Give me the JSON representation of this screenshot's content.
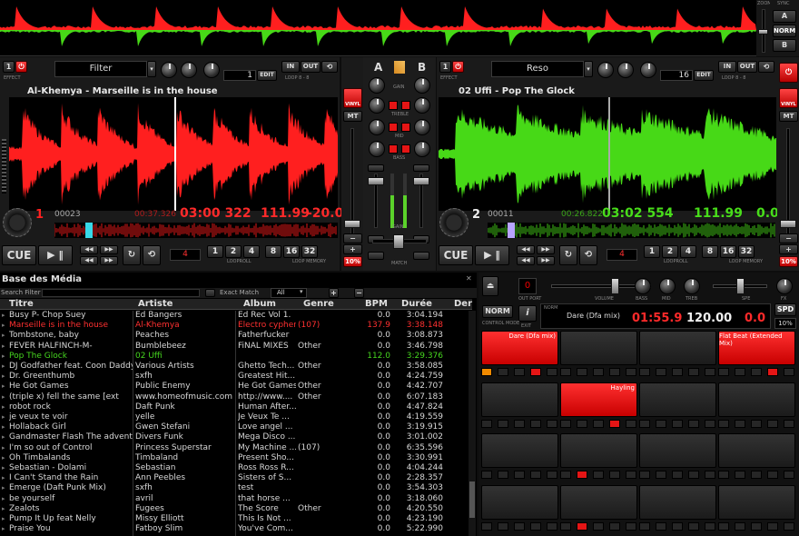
{
  "colors": {
    "deck_a_wave": "#ff1f1f",
    "deck_b_wave": "#47d917",
    "accent_red": "#e51515",
    "lib_red": "#ff3030",
    "lib_green": "#46d61f"
  },
  "top": {
    "zoom_label": "ZOOM",
    "sync_label": "SYNC",
    "btn_a": "A",
    "btn_norm": "NORM",
    "btn_b": "B"
  },
  "deckA": {
    "effect_name": "Filter",
    "effect_label": "EFFECT",
    "loop_value": "1",
    "edit": "EDIT",
    "loop_label": "LOOP 8 - 8",
    "in": "IN",
    "out": "OUT",
    "track": "Al-Khemya - Marseille is in the house",
    "deck_num": "1",
    "beat_count": "00023",
    "elapsed": "00:37.326",
    "remain": "03:00 322",
    "bpm": "111.99",
    "pitch": "-20.0",
    "cue": "CUE",
    "loop_display": "4",
    "loop_roll_label": "LOOPROLL",
    "loop_memory_label": "LOOP MEMORY",
    "loop_nums": [
      "1",
      "2",
      "4",
      "8",
      "16",
      "32"
    ],
    "vinyl": "VINYL",
    "mt": "MT",
    "pct": "10%"
  },
  "deckB": {
    "effect_name": "Reso",
    "effect_label": "EFFECT",
    "loop_value": "16",
    "edit": "EDIT",
    "loop_label": "LOOP 8 - 8",
    "in": "IN",
    "out": "OUT",
    "track": "02 Uffi - Pop The Glock",
    "deck_num": "2",
    "beat_count": "00011",
    "elapsed": "00:26.822",
    "remain": "03:02 554",
    "bpm": "111.99",
    "pitch": "0.0",
    "cue": "CUE",
    "loop_display": "4",
    "loop_roll_label": "LOOPROLL",
    "loop_memory_label": "LOOP MEMORY",
    "loop_nums": [
      "1",
      "2",
      "4",
      "8",
      "16",
      "32"
    ],
    "vinyl": "VINYL",
    "mt": "MT",
    "pct": "10%"
  },
  "mixer": {
    "a": "A",
    "b": "B",
    "labels": [
      "GAIN",
      "TREBLE",
      "MID",
      "BASS"
    ],
    "kill": "KILL",
    "gain": "GAIN",
    "mix": "MIX",
    "fx": "FX",
    "cross": "CROSSFADER",
    "match": "MATCH"
  },
  "library": {
    "title": "Base des Média",
    "filter_label": "Search Filter",
    "exact_match": "Exact Match",
    "all_option": "All",
    "columns": [
      "Titre",
      "Artiste",
      "Album",
      "Genre",
      "BPM",
      "Durée",
      "Der"
    ],
    "rows": [
      [
        "Busy P- Chop Suey",
        "Ed Bangers",
        "Ed Rec Vol 1.",
        "",
        "0.0",
        "3:04.194",
        "n"
      ],
      [
        "Marseille is in the house",
        "Al-Khemya",
        "Electro cypher",
        "(107)",
        "137.9",
        "3:38.148",
        "r"
      ],
      [
        "Tombstone, baby",
        "Peaches",
        "Fatherfucker",
        "",
        "0.0",
        "3:08.873",
        "n"
      ],
      [
        "FEVER HALFINCH-M-",
        "Bumblebeez",
        "FiNAL MIXES",
        "Other",
        "0.0",
        "3:46.798",
        "n"
      ],
      [
        "Pop The Glock",
        "02 Uffi",
        "",
        "",
        "112.0",
        "3:29.376",
        "g"
      ],
      [
        "DJ Godfather feat. Coon Daddy",
        "Various Artists",
        "Ghetto Tech...",
        "Other",
        "0.0",
        "3:58.085",
        "n"
      ],
      [
        "Dr. Greenthumb",
        "sxfh",
        "Greatest Hit...",
        "",
        "0.0",
        "4:24.759",
        "n"
      ],
      [
        "He Got Games",
        "Public Enemy",
        "He Got Games",
        "Other",
        "0.0",
        "4:42.707",
        "n"
      ],
      [
        "(triple x) fell the same [ext",
        "www.homeofmusic.com",
        "http://www....",
        "Other",
        "0.0",
        "6:07.183",
        "n"
      ],
      [
        "robot rock",
        "Daft Punk",
        "Human After...",
        "",
        "0.0",
        "4:47.824",
        "n"
      ],
      [
        "je veux te voir",
        "yelle",
        "Je Veux Te ...",
        "",
        "0.0",
        "4:19.559",
        "n"
      ],
      [
        "Hollaback Girl",
        "Gwen Stefani",
        "Love angel ...",
        "",
        "0.0",
        "3:19.915",
        "n"
      ],
      [
        "Gandmaster Flash  The adventu",
        "Divers Funk",
        "Mega Disco ...",
        "",
        "0.0",
        "3:01.002",
        "n"
      ],
      [
        "I'm so out of Control",
        "Princess Superstar",
        "My Machine ...",
        "(107)",
        "0.0",
        "6:35.596",
        "n"
      ],
      [
        "Oh Timbalands",
        "Timbaland",
        "Present Sho...",
        "",
        "0.0",
        "3:30.991",
        "n"
      ],
      [
        "Sebastian - Dolami",
        "Sebastian",
        "Ross Ross R...",
        "",
        "0.0",
        "4:04.244",
        "n"
      ],
      [
        "I Can't Stand the Rain",
        "Ann Peebles",
        "Sisters of S...",
        "",
        "0.0",
        "2:28.357",
        "n"
      ],
      [
        "Emerge (Daft Punk Mix)",
        "sxfh",
        "test",
        "",
        "0.0",
        "3:54.303",
        "n"
      ],
      [
        "be yourself",
        "avril",
        "that horse ...",
        "",
        "0.0",
        "3:18.060",
        "n"
      ],
      [
        "Zealots",
        "Fugees",
        "The Score",
        "Other",
        "0.0",
        "4:20.550",
        "n"
      ],
      [
        "Pump It Up feat Nelly",
        "Missy Elliott",
        "This Is Not ...",
        "",
        "0.0",
        "4:23.190",
        "n"
      ],
      [
        "Praise You",
        "Fatboy Slim",
        "You've Com...",
        "",
        "0.0",
        "5:22.990",
        "n"
      ]
    ]
  },
  "sampler": {
    "out_port": "OUT PORT",
    "volume_label": "VOLUME",
    "fx_label": "FX",
    "norm": "NORM",
    "info": "i",
    "control_mode": "CONTROL MODE",
    "exit": "EXIT",
    "norm_label": "NORM",
    "track": "Dare (Dfa mix)",
    "time": "01:55.9",
    "bpm": "120.00",
    "pitch": "0.0",
    "spd": "SPD",
    "pct": "10%",
    "knobs": [
      "BASS",
      "MID",
      "TREB"
    ],
    "spe": "SPE",
    "pads": [
      {
        "label": "Dare (Dfa mix)",
        "on": true
      },
      {
        "label": "",
        "on": false
      },
      {
        "label": "",
        "on": false
      },
      {
        "label": "Flat Beat (Extended Mix)",
        "on": true
      },
      {
        "label": "",
        "on": false
      },
      {
        "label": "Hayling",
        "on": true
      },
      {
        "label": "",
        "on": false
      },
      {
        "label": "",
        "on": false
      },
      {
        "label": "",
        "on": false
      },
      {
        "label": "",
        "on": false
      },
      {
        "label": "",
        "on": false
      },
      {
        "label": "",
        "on": false
      },
      {
        "label": "",
        "on": false
      },
      {
        "label": "",
        "on": false
      },
      {
        "label": "",
        "on": false
      },
      {
        "label": "",
        "on": false
      }
    ]
  }
}
